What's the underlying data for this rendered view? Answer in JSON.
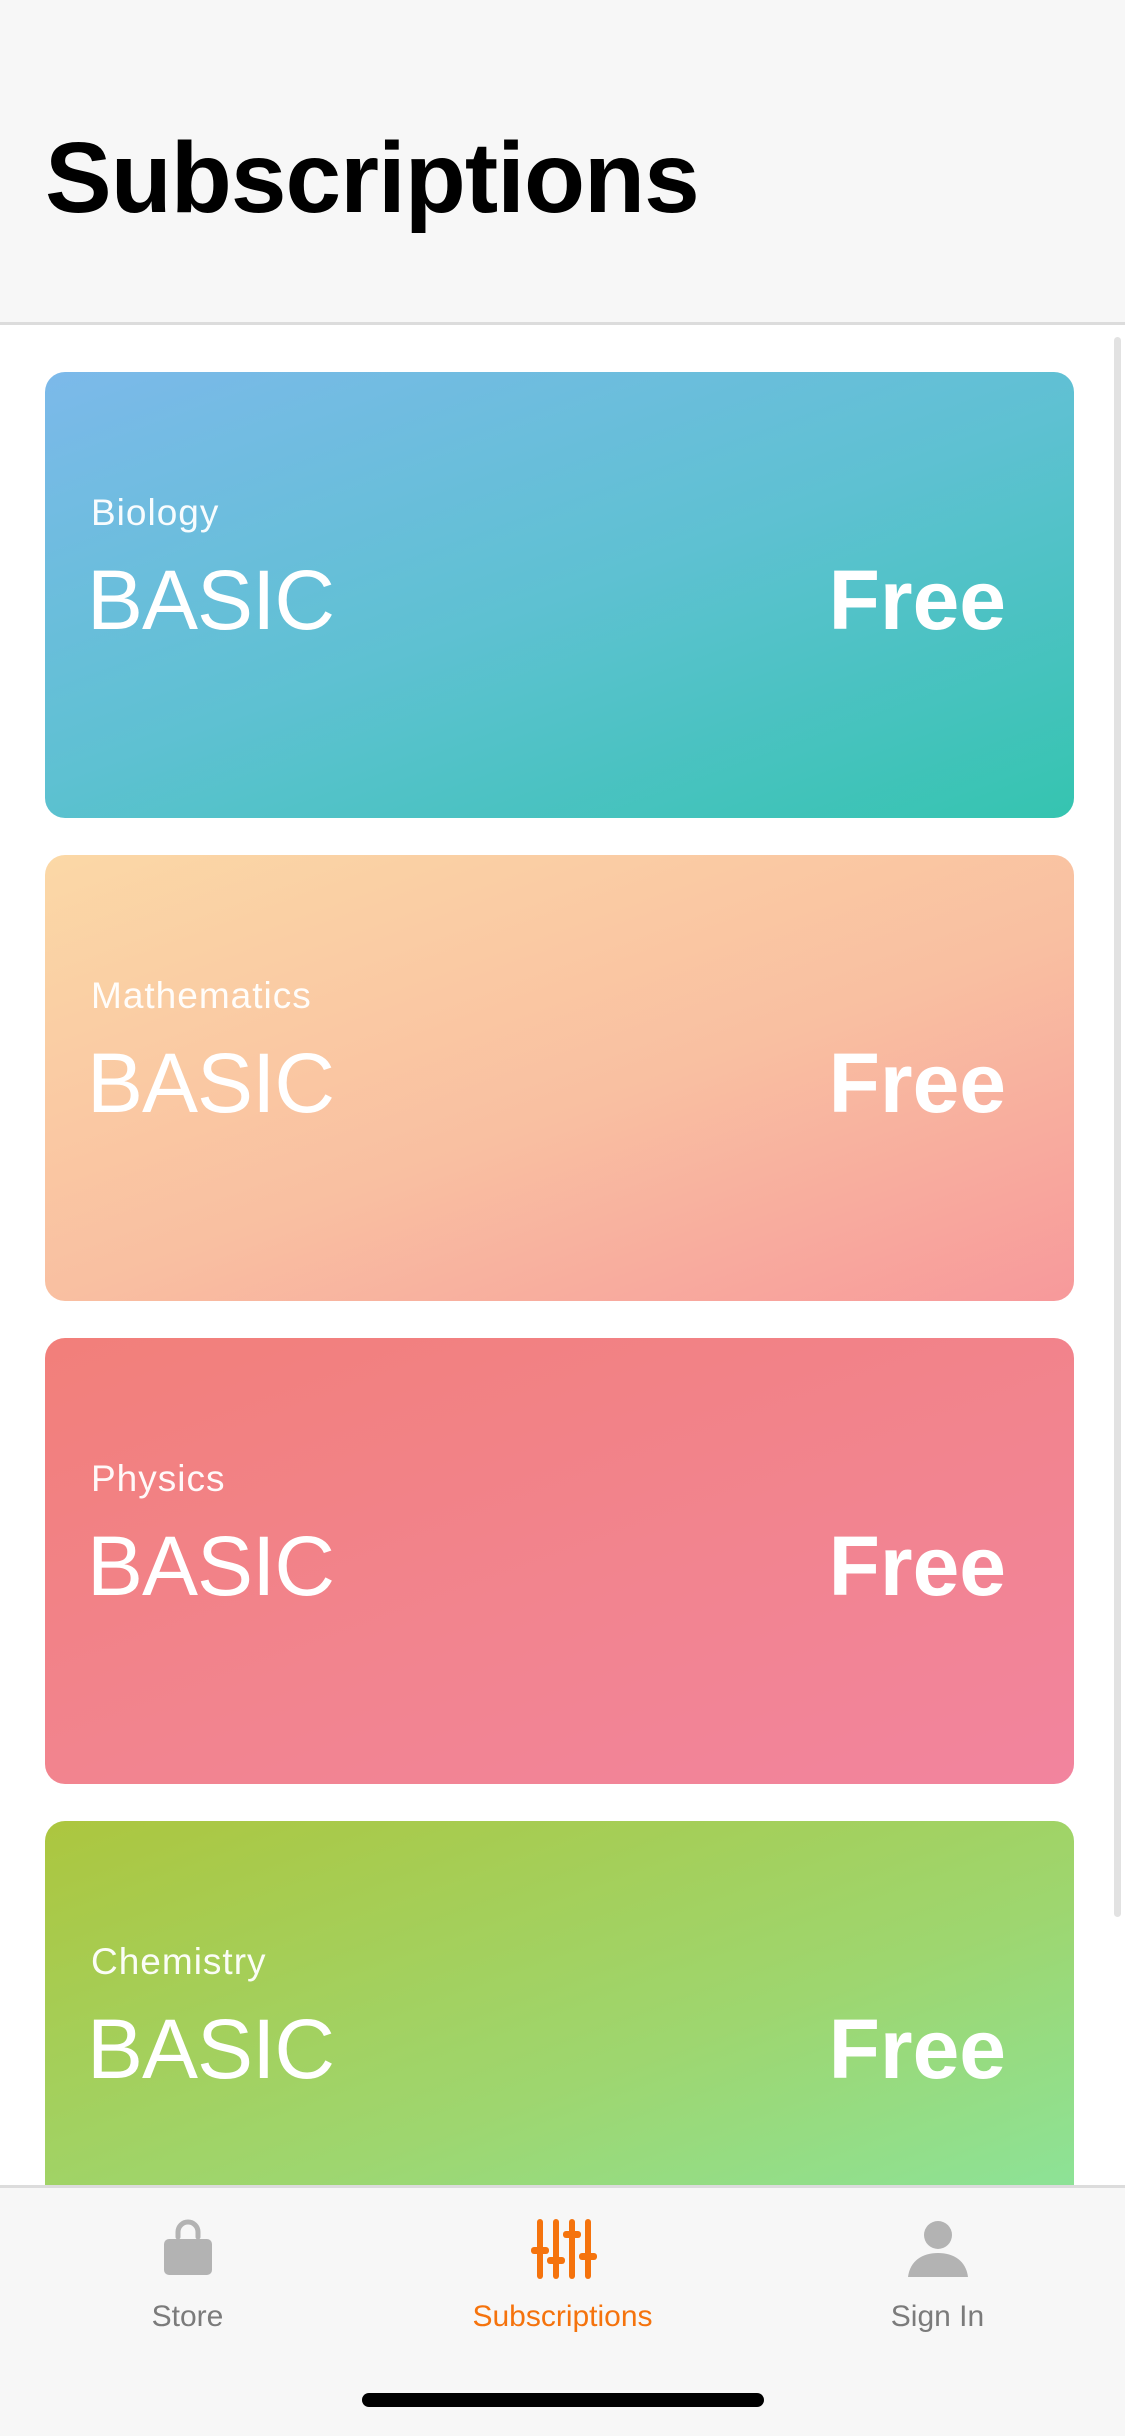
{
  "header": {
    "title": "Subscriptions"
  },
  "cards": [
    {
      "subject": "Biology",
      "plan": "BASIC",
      "price": "Free"
    },
    {
      "subject": "Mathematics",
      "plan": "BASIC",
      "price": "Free"
    },
    {
      "subject": "Physics",
      "plan": "BASIC",
      "price": "Free"
    },
    {
      "subject": "Chemistry",
      "plan": "BASIC",
      "price": "Free"
    }
  ],
  "tab_bar": {
    "tabs": [
      {
        "label": "Store",
        "icon": "shopping-bag-icon",
        "active": false
      },
      {
        "label": "Subscriptions",
        "icon": "sliders-icon",
        "active": true
      },
      {
        "label": "Sign In",
        "icon": "person-icon",
        "active": false
      }
    ]
  },
  "colors": {
    "accent": "#f5730d",
    "inactive_tab": "#7b7b7b",
    "card_gradients": [
      [
        "#7cb9ea",
        "#35c4b0"
      ],
      [
        "#fbd8a6",
        "#f7999b"
      ],
      [
        "#f27f7a",
        "#f2849e"
      ],
      [
        "#acc63f",
        "#88e6a2"
      ]
    ]
  }
}
